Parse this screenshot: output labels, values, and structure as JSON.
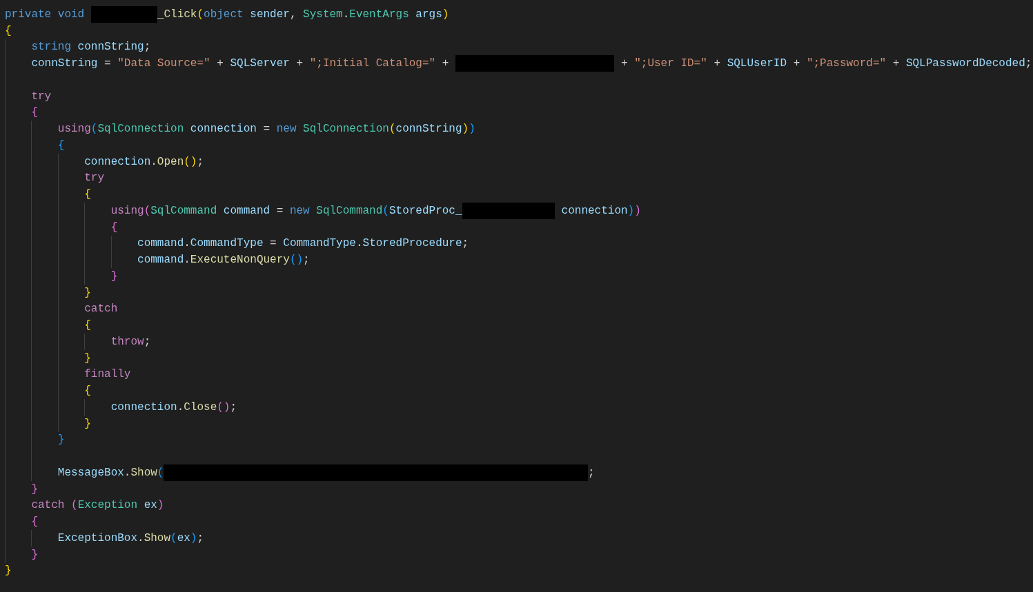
{
  "editor": {
    "lines": [
      {
        "kind": "code",
        "tokens": [
          {
            "kind": "keyword",
            "text": "private void "
          },
          {
            "kind": "redacted"
          },
          {
            "kind": "function",
            "text": "_Click"
          },
          {
            "kind": "bracket1",
            "text": "("
          },
          {
            "kind": "keyword",
            "text": "object"
          },
          {
            "kind": "variable",
            "text": " sender"
          },
          {
            "kind": "plain",
            "text": ", "
          },
          {
            "kind": "type",
            "text": "System"
          },
          {
            "kind": "plain",
            "text": "."
          },
          {
            "kind": "type",
            "text": "EventArgs"
          },
          {
            "kind": "variable",
            "text": " args"
          },
          {
            "kind": "bracket1",
            "text": ")"
          }
        ]
      },
      {
        "kind": "code",
        "tokens": [
          {
            "kind": "bracket1",
            "text": "{"
          }
        ],
        "children": [
          {
            "kind": "code",
            "tokens": [
              {
                "kind": "keyword",
                "text": "string"
              },
              {
                "kind": "variable",
                "text": " connString"
              },
              {
                "kind": "plain",
                "text": ";"
              }
            ]
          },
          {
            "kind": "code",
            "tokens": [
              {
                "kind": "variable",
                "text": "connString"
              },
              {
                "kind": "plain",
                "text": " = "
              },
              {
                "kind": "string",
                "text": "\"Data Source=\""
              },
              {
                "kind": "plain",
                "text": " + "
              },
              {
                "kind": "variable",
                "text": "SQLServer"
              },
              {
                "kind": "plain",
                "text": " + "
              },
              {
                "kind": "string",
                "text": "\";Initial Catalog=\""
              },
              {
                "kind": "plain",
                "text": " + "
              },
              {
                "kind": "redacted"
              },
              {
                "kind": "plain",
                "text": " + "
              },
              {
                "kind": "string",
                "text": "\";User ID=\""
              },
              {
                "kind": "plain",
                "text": " + "
              },
              {
                "kind": "variable",
                "text": "SQLUserID"
              },
              {
                "kind": "plain",
                "text": " + "
              },
              {
                "kind": "string",
                "text": "\";Password=\""
              },
              {
                "kind": "plain",
                "text": " + "
              },
              {
                "kind": "variable",
                "text": "SQLPasswordDecoded"
              },
              {
                "kind": "plain",
                "text": ";"
              }
            ]
          },
          {
            "kind": "blank"
          },
          {
            "kind": "code",
            "tokens": [
              {
                "kind": "control",
                "text": "try"
              }
            ]
          },
          {
            "kind": "code",
            "tokens": [
              {
                "kind": "bracket2",
                "text": "{"
              }
            ],
            "children": [
              {
                "kind": "code",
                "tokens": [
                  {
                    "kind": "control",
                    "text": "using"
                  },
                  {
                    "kind": "bracket3",
                    "text": "("
                  },
                  {
                    "kind": "type",
                    "text": "SqlConnection"
                  },
                  {
                    "kind": "variable",
                    "text": " connection"
                  },
                  {
                    "kind": "plain",
                    "text": " = "
                  },
                  {
                    "kind": "keyword",
                    "text": "new"
                  },
                  {
                    "kind": "type",
                    "text": " SqlConnection"
                  },
                  {
                    "kind": "bracket1",
                    "text": "("
                  },
                  {
                    "kind": "variable",
                    "text": "connString"
                  },
                  {
                    "kind": "bracket1",
                    "text": ")"
                  },
                  {
                    "kind": "bracket3",
                    "text": ")"
                  }
                ]
              },
              {
                "kind": "code",
                "tokens": [
                  {
                    "kind": "bracket3",
                    "text": "{"
                  }
                ],
                "children": [
                  {
                    "kind": "code",
                    "tokens": [
                      {
                        "kind": "variable",
                        "text": "connection"
                      },
                      {
                        "kind": "plain",
                        "text": "."
                      },
                      {
                        "kind": "function",
                        "text": "Open"
                      },
                      {
                        "kind": "bracket1",
                        "text": "()"
                      },
                      {
                        "kind": "plain",
                        "text": ";"
                      }
                    ]
                  },
                  {
                    "kind": "code",
                    "tokens": [
                      {
                        "kind": "control",
                        "text": "try"
                      }
                    ]
                  },
                  {
                    "kind": "code",
                    "tokens": [
                      {
                        "kind": "bracket1",
                        "text": "{"
                      }
                    ],
                    "children": [
                      {
                        "kind": "code",
                        "tokens": [
                          {
                            "kind": "control",
                            "text": "using"
                          },
                          {
                            "kind": "bracket2",
                            "text": "("
                          },
                          {
                            "kind": "type",
                            "text": "SqlCommand"
                          },
                          {
                            "kind": "variable",
                            "text": " command"
                          },
                          {
                            "kind": "plain",
                            "text": " = "
                          },
                          {
                            "kind": "keyword",
                            "text": "new"
                          },
                          {
                            "kind": "type",
                            "text": " SqlCommand"
                          },
                          {
                            "kind": "bracket3",
                            "text": "("
                          },
                          {
                            "kind": "variable",
                            "text": "StoredProc_"
                          },
                          {
                            "kind": "redacted"
                          },
                          {
                            "kind": "variable",
                            "text": " connection"
                          },
                          {
                            "kind": "bracket3",
                            "text": ")"
                          },
                          {
                            "kind": "bracket2",
                            "text": ")"
                          }
                        ]
                      },
                      {
                        "kind": "code",
                        "tokens": [
                          {
                            "kind": "bracket2",
                            "text": "{"
                          }
                        ],
                        "children": [
                          {
                            "kind": "code",
                            "tokens": [
                              {
                                "kind": "variable",
                                "text": "command"
                              },
                              {
                                "kind": "plain",
                                "text": "."
                              },
                              {
                                "kind": "variable",
                                "text": "CommandType"
                              },
                              {
                                "kind": "plain",
                                "text": " = "
                              },
                              {
                                "kind": "variable",
                                "text": "CommandType"
                              },
                              {
                                "kind": "plain",
                                "text": "."
                              },
                              {
                                "kind": "variable",
                                "text": "StoredProcedure"
                              },
                              {
                                "kind": "plain",
                                "text": ";"
                              }
                            ]
                          },
                          {
                            "kind": "code",
                            "tokens": [
                              {
                                "kind": "variable",
                                "text": "command"
                              },
                              {
                                "kind": "plain",
                                "text": "."
                              },
                              {
                                "kind": "function",
                                "text": "ExecuteNonQuery"
                              },
                              {
                                "kind": "bracket3",
                                "text": "()"
                              },
                              {
                                "kind": "plain",
                                "text": ";"
                              }
                            ]
                          }
                        ]
                      },
                      {
                        "kind": "code",
                        "tokens": [
                          {
                            "kind": "bracket2",
                            "text": "}"
                          }
                        ]
                      }
                    ]
                  },
                  {
                    "kind": "code",
                    "tokens": [
                      {
                        "kind": "bracket1",
                        "text": "}"
                      }
                    ]
                  },
                  {
                    "kind": "code",
                    "tokens": [
                      {
                        "kind": "control",
                        "text": "catch"
                      }
                    ]
                  },
                  {
                    "kind": "code",
                    "tokens": [
                      {
                        "kind": "bracket1",
                        "text": "{"
                      }
                    ],
                    "children": [
                      {
                        "kind": "code",
                        "tokens": [
                          {
                            "kind": "control",
                            "text": "throw"
                          },
                          {
                            "kind": "plain",
                            "text": ";"
                          }
                        ]
                      }
                    ]
                  },
                  {
                    "kind": "code",
                    "tokens": [
                      {
                        "kind": "bracket1",
                        "text": "}"
                      }
                    ]
                  },
                  {
                    "kind": "code",
                    "tokens": [
                      {
                        "kind": "control",
                        "text": "finally"
                      }
                    ]
                  },
                  {
                    "kind": "code",
                    "tokens": [
                      {
                        "kind": "bracket1",
                        "text": "{"
                      }
                    ],
                    "children": [
                      {
                        "kind": "code",
                        "tokens": [
                          {
                            "kind": "variable",
                            "text": "connection"
                          },
                          {
                            "kind": "plain",
                            "text": "."
                          },
                          {
                            "kind": "function",
                            "text": "Close"
                          },
                          {
                            "kind": "bracket2",
                            "text": "()"
                          },
                          {
                            "kind": "plain",
                            "text": ";"
                          }
                        ]
                      }
                    ]
                  },
                  {
                    "kind": "code",
                    "tokens": [
                      {
                        "kind": "bracket1",
                        "text": "}"
                      }
                    ]
                  }
                ]
              },
              {
                "kind": "code",
                "tokens": [
                  {
                    "kind": "bracket3",
                    "text": "}"
                  }
                ]
              },
              {
                "kind": "blank"
              },
              {
                "kind": "code",
                "tokens": [
                  {
                    "kind": "variable",
                    "text": "MessageBox"
                  },
                  {
                    "kind": "plain",
                    "text": "."
                  },
                  {
                    "kind": "function",
                    "text": "Show"
                  },
                  {
                    "kind": "bracket3",
                    "text": "("
                  },
                  {
                    "kind": "redacted"
                  },
                  {
                    "kind": "plain",
                    "text": ";"
                  }
                ]
              }
            ]
          },
          {
            "kind": "code",
            "tokens": [
              {
                "kind": "bracket2",
                "text": "}"
              }
            ]
          },
          {
            "kind": "code",
            "tokens": [
              {
                "kind": "control",
                "text": "catch"
              },
              {
                "kind": "bracket2",
                "text": " ("
              },
              {
                "kind": "type",
                "text": "Exception"
              },
              {
                "kind": "variable",
                "text": " ex"
              },
              {
                "kind": "bracket2",
                "text": ")"
              }
            ]
          },
          {
            "kind": "code",
            "tokens": [
              {
                "kind": "bracket2",
                "text": "{"
              }
            ],
            "children": [
              {
                "kind": "code",
                "tokens": [
                  {
                    "kind": "variable",
                    "text": "ExceptionBox"
                  },
                  {
                    "kind": "plain",
                    "text": "."
                  },
                  {
                    "kind": "function",
                    "text": "Show"
                  },
                  {
                    "kind": "bracket3",
                    "text": "("
                  },
                  {
                    "kind": "variable",
                    "text": "ex"
                  },
                  {
                    "kind": "bracket3",
                    "text": ")"
                  },
                  {
                    "kind": "plain",
                    "text": ";"
                  }
                ]
              }
            ]
          },
          {
            "kind": "code",
            "tokens": [
              {
                "kind": "bracket2",
                "text": "}"
              }
            ]
          }
        ]
      },
      {
        "kind": "code",
        "tokens": [
          {
            "kind": "bracket1",
            "text": "}"
          }
        ]
      }
    ]
  }
}
